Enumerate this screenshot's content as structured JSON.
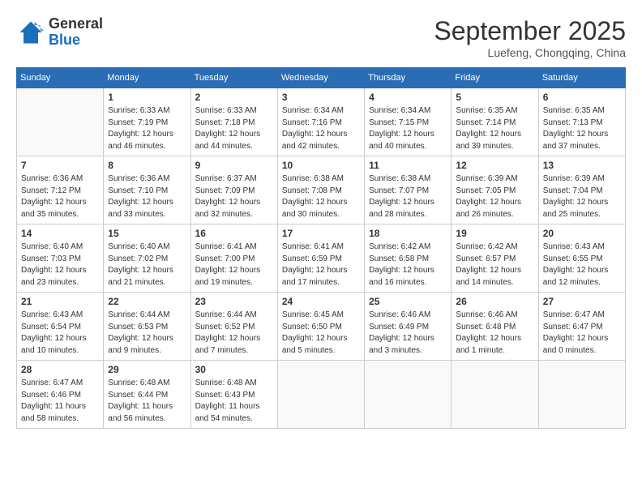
{
  "header": {
    "logo_line1": "General",
    "logo_line2": "Blue",
    "month_year": "September 2025",
    "location": "Luefeng, Chongqing, China"
  },
  "weekdays": [
    "Sunday",
    "Monday",
    "Tuesday",
    "Wednesday",
    "Thursday",
    "Friday",
    "Saturday"
  ],
  "weeks": [
    [
      {
        "day": "",
        "info": ""
      },
      {
        "day": "1",
        "info": "Sunrise: 6:33 AM\nSunset: 7:19 PM\nDaylight: 12 hours\nand 46 minutes."
      },
      {
        "day": "2",
        "info": "Sunrise: 6:33 AM\nSunset: 7:18 PM\nDaylight: 12 hours\nand 44 minutes."
      },
      {
        "day": "3",
        "info": "Sunrise: 6:34 AM\nSunset: 7:16 PM\nDaylight: 12 hours\nand 42 minutes."
      },
      {
        "day": "4",
        "info": "Sunrise: 6:34 AM\nSunset: 7:15 PM\nDaylight: 12 hours\nand 40 minutes."
      },
      {
        "day": "5",
        "info": "Sunrise: 6:35 AM\nSunset: 7:14 PM\nDaylight: 12 hours\nand 39 minutes."
      },
      {
        "day": "6",
        "info": "Sunrise: 6:35 AM\nSunset: 7:13 PM\nDaylight: 12 hours\nand 37 minutes."
      }
    ],
    [
      {
        "day": "7",
        "info": "Sunrise: 6:36 AM\nSunset: 7:12 PM\nDaylight: 12 hours\nand 35 minutes."
      },
      {
        "day": "8",
        "info": "Sunrise: 6:36 AM\nSunset: 7:10 PM\nDaylight: 12 hours\nand 33 minutes."
      },
      {
        "day": "9",
        "info": "Sunrise: 6:37 AM\nSunset: 7:09 PM\nDaylight: 12 hours\nand 32 minutes."
      },
      {
        "day": "10",
        "info": "Sunrise: 6:38 AM\nSunset: 7:08 PM\nDaylight: 12 hours\nand 30 minutes."
      },
      {
        "day": "11",
        "info": "Sunrise: 6:38 AM\nSunset: 7:07 PM\nDaylight: 12 hours\nand 28 minutes."
      },
      {
        "day": "12",
        "info": "Sunrise: 6:39 AM\nSunset: 7:05 PM\nDaylight: 12 hours\nand 26 minutes."
      },
      {
        "day": "13",
        "info": "Sunrise: 6:39 AM\nSunset: 7:04 PM\nDaylight: 12 hours\nand 25 minutes."
      }
    ],
    [
      {
        "day": "14",
        "info": "Sunrise: 6:40 AM\nSunset: 7:03 PM\nDaylight: 12 hours\nand 23 minutes."
      },
      {
        "day": "15",
        "info": "Sunrise: 6:40 AM\nSunset: 7:02 PM\nDaylight: 12 hours\nand 21 minutes."
      },
      {
        "day": "16",
        "info": "Sunrise: 6:41 AM\nSunset: 7:00 PM\nDaylight: 12 hours\nand 19 minutes."
      },
      {
        "day": "17",
        "info": "Sunrise: 6:41 AM\nSunset: 6:59 PM\nDaylight: 12 hours\nand 17 minutes."
      },
      {
        "day": "18",
        "info": "Sunrise: 6:42 AM\nSunset: 6:58 PM\nDaylight: 12 hours\nand 16 minutes."
      },
      {
        "day": "19",
        "info": "Sunrise: 6:42 AM\nSunset: 6:57 PM\nDaylight: 12 hours\nand 14 minutes."
      },
      {
        "day": "20",
        "info": "Sunrise: 6:43 AM\nSunset: 6:55 PM\nDaylight: 12 hours\nand 12 minutes."
      }
    ],
    [
      {
        "day": "21",
        "info": "Sunrise: 6:43 AM\nSunset: 6:54 PM\nDaylight: 12 hours\nand 10 minutes."
      },
      {
        "day": "22",
        "info": "Sunrise: 6:44 AM\nSunset: 6:53 PM\nDaylight: 12 hours\nand 9 minutes."
      },
      {
        "day": "23",
        "info": "Sunrise: 6:44 AM\nSunset: 6:52 PM\nDaylight: 12 hours\nand 7 minutes."
      },
      {
        "day": "24",
        "info": "Sunrise: 6:45 AM\nSunset: 6:50 PM\nDaylight: 12 hours\nand 5 minutes."
      },
      {
        "day": "25",
        "info": "Sunrise: 6:46 AM\nSunset: 6:49 PM\nDaylight: 12 hours\nand 3 minutes."
      },
      {
        "day": "26",
        "info": "Sunrise: 6:46 AM\nSunset: 6:48 PM\nDaylight: 12 hours\nand 1 minute."
      },
      {
        "day": "27",
        "info": "Sunrise: 6:47 AM\nSunset: 6:47 PM\nDaylight: 12 hours\nand 0 minutes."
      }
    ],
    [
      {
        "day": "28",
        "info": "Sunrise: 6:47 AM\nSunset: 6:46 PM\nDaylight: 11 hours\nand 58 minutes."
      },
      {
        "day": "29",
        "info": "Sunrise: 6:48 AM\nSunset: 6:44 PM\nDaylight: 11 hours\nand 56 minutes."
      },
      {
        "day": "30",
        "info": "Sunrise: 6:48 AM\nSunset: 6:43 PM\nDaylight: 11 hours\nand 54 minutes."
      },
      {
        "day": "",
        "info": ""
      },
      {
        "day": "",
        "info": ""
      },
      {
        "day": "",
        "info": ""
      },
      {
        "day": "",
        "info": ""
      }
    ]
  ]
}
